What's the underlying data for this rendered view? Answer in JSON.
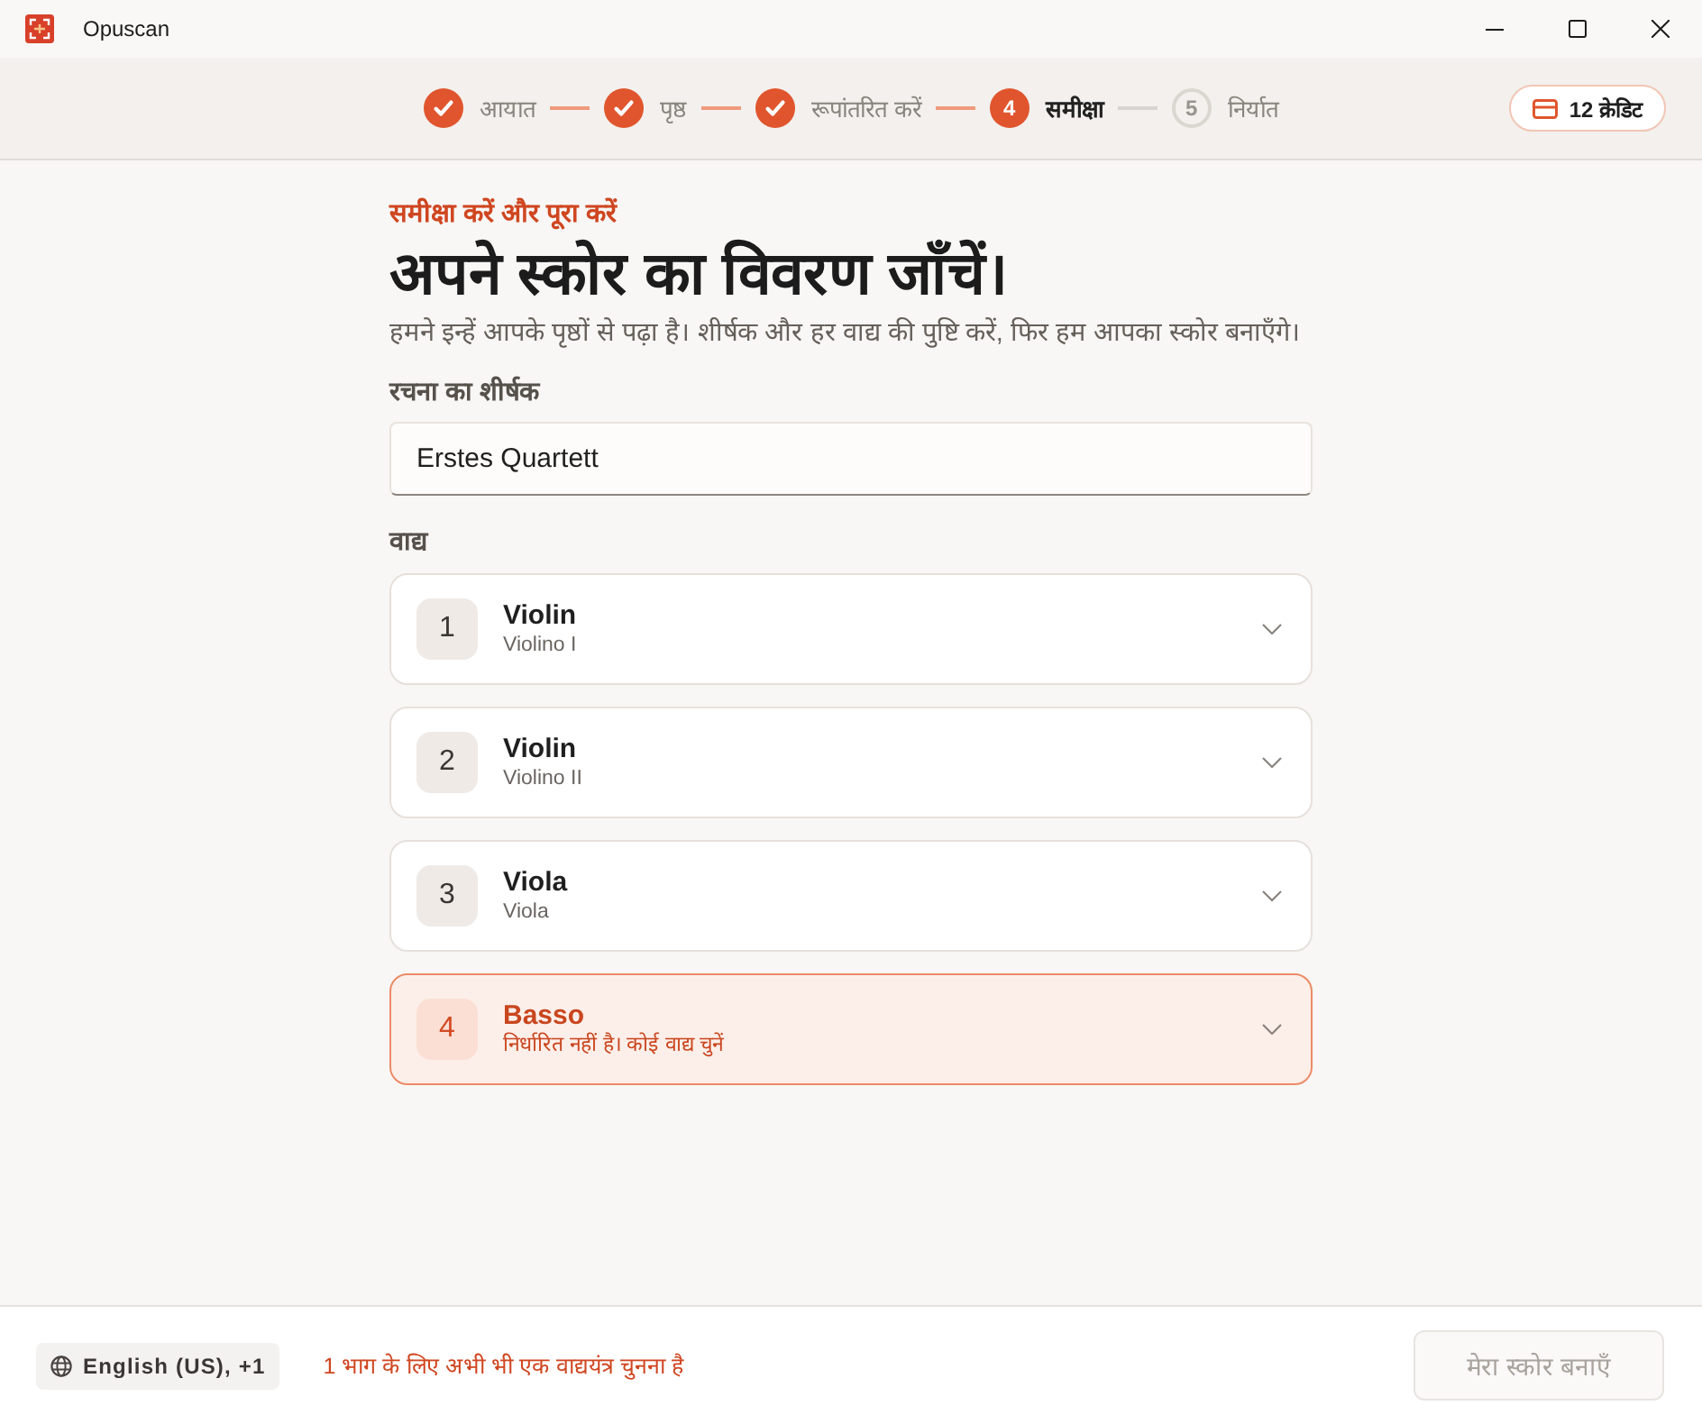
{
  "window": {
    "title": "Opuscan"
  },
  "stepper": {
    "steps": [
      {
        "label": "आयात",
        "completed": true,
        "current": false
      },
      {
        "label": "पृष्ठ",
        "completed": true,
        "current": false
      },
      {
        "label": "रूपांतरित करें",
        "completed": true,
        "current": false
      },
      {
        "number": "4",
        "label": "समीक्षा",
        "completed": false,
        "current": true
      },
      {
        "number": "5",
        "label": "निर्यात",
        "completed": false,
        "current": false
      }
    ]
  },
  "credits": {
    "label": "12 क्रेडिट"
  },
  "review": {
    "eyebrow": "समीक्षा करें और पूरा करें",
    "heading": "अपने स्कोर का विवरण जाँचें।",
    "description": "हमने इन्हें आपके पृष्ठों से पढ़ा है। शीर्षक और हर वाद्य की पुष्टि करें, फिर हम आपका स्कोर बनाएँगे।",
    "title_field": {
      "label": "रचना का शीर्षक",
      "value": "Erstes Quartett"
    },
    "instruments_label": "वाद्य",
    "instruments": [
      {
        "number": "1",
        "name": "Violin",
        "detail": "Violino I",
        "needs_attention": false
      },
      {
        "number": "2",
        "name": "Violin",
        "detail": "Violino II",
        "needs_attention": false
      },
      {
        "number": "3",
        "name": "Viola",
        "detail": "Viola",
        "needs_attention": false
      },
      {
        "number": "4",
        "name": "Basso",
        "detail": "निर्धारित नहीं है। कोई वाद्य चुनें",
        "needs_attention": true
      }
    ]
  },
  "footer": {
    "language": "English (US), +1",
    "warning": "1 भाग के लिए अभी भी एक वाद्ययंत्र चुनना है",
    "create_button": {
      "label": "मेरा स्कोर बनाएँ",
      "disabled": true
    }
  }
}
